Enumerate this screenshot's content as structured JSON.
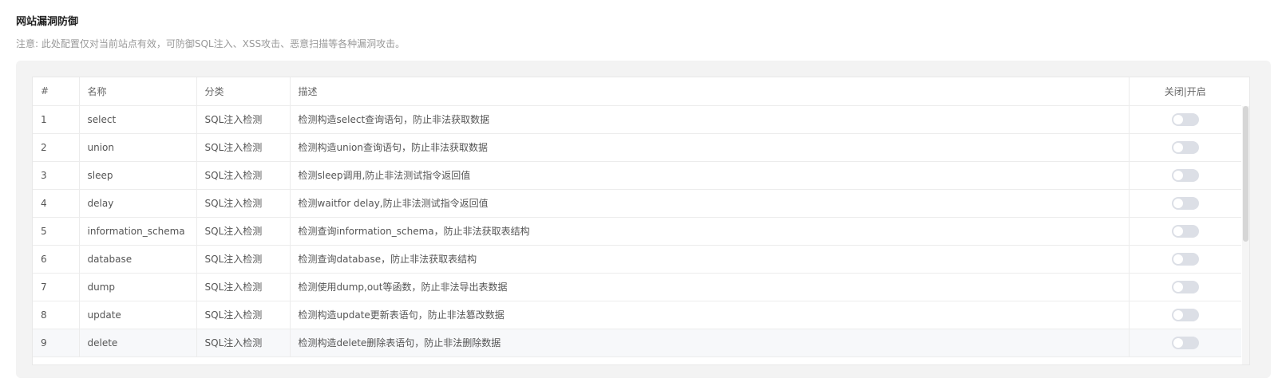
{
  "page": {
    "title": "网站漏洞防御",
    "note": "注意: 此处配置仅对当前站点有效，可防御SQL注入、XSS攻击、恶意扫描等各种漏洞攻击。"
  },
  "table": {
    "headers": [
      "#",
      "名称",
      "分类",
      "描述",
      "关闭|开启"
    ],
    "rows": [
      {
        "id": "1",
        "name": "select",
        "category": "SQL注入检测",
        "desc": "检测构造select查询语句，防止非法获取数据",
        "enabled": false
      },
      {
        "id": "2",
        "name": "union",
        "category": "SQL注入检测",
        "desc": "检测构造union查询语句，防止非法获取数据",
        "enabled": false
      },
      {
        "id": "3",
        "name": "sleep",
        "category": "SQL注入检测",
        "desc": "检测sleep调用,防止非法测试指令返回值",
        "enabled": false
      },
      {
        "id": "4",
        "name": "delay",
        "category": "SQL注入检测",
        "desc": "检测waitfor delay,防止非法测试指令返回值",
        "enabled": false
      },
      {
        "id": "5",
        "name": "information_schema",
        "category": "SQL注入检测",
        "desc": "检测查询information_schema，防止非法获取表结构",
        "enabled": false
      },
      {
        "id": "6",
        "name": "database",
        "category": "SQL注入检测",
        "desc": "检测查询database，防止非法获取表结构",
        "enabled": false
      },
      {
        "id": "7",
        "name": "dump",
        "category": "SQL注入检测",
        "desc": "检测使用dump,out等函数，防止非法导出表数据",
        "enabled": false
      },
      {
        "id": "8",
        "name": "update",
        "category": "SQL注入检测",
        "desc": "检测构造update更新表语句，防止非法篡改数据",
        "enabled": false
      },
      {
        "id": "9",
        "name": "delete",
        "category": "SQL注入检测",
        "desc": "检测构造delete删除表语句，防止非法删除数据",
        "enabled": false
      }
    ]
  },
  "colors": {
    "toggle_off": "#dcdfe6",
    "hover_row": "#f7f8fa"
  }
}
